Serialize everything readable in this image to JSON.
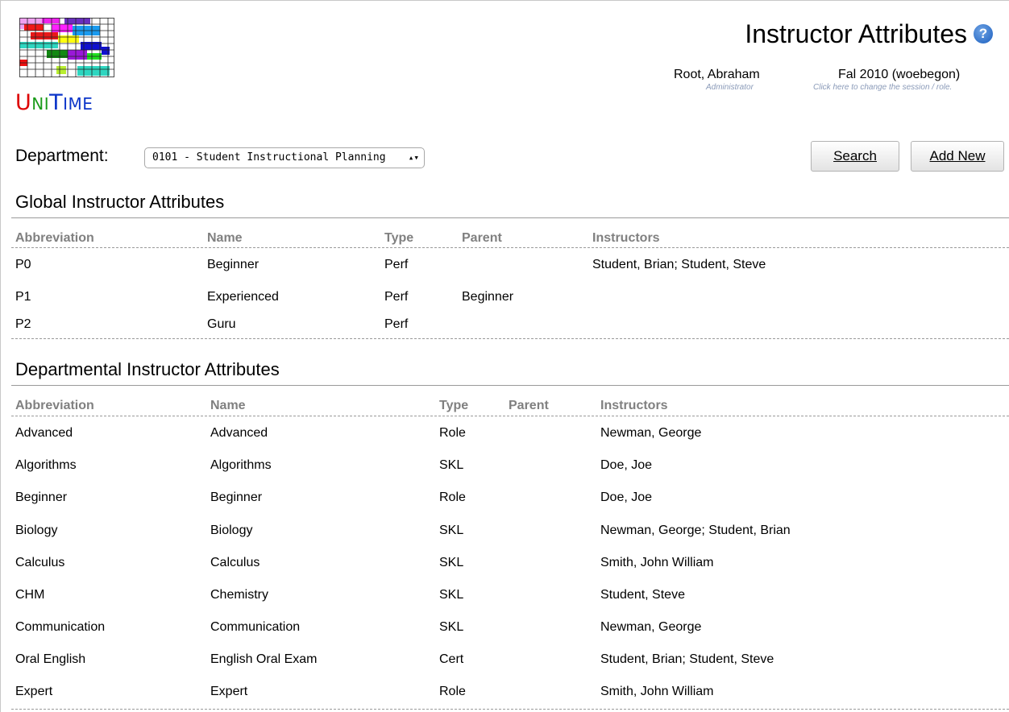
{
  "app": {
    "logo_parts": [
      "U",
      "NI",
      "T",
      "IME"
    ]
  },
  "header": {
    "title": "Instructor Attributes",
    "help_icon": "help-icon",
    "help_glyph": "?",
    "user": {
      "name": "Root, Abraham",
      "role": "Administrator"
    },
    "session": {
      "name": "Fal 2010 (woebegon)",
      "hint": "Click here to change the session / role."
    }
  },
  "filter": {
    "department_label": "Department:",
    "department_value": "0101 - Student Instructional Planning",
    "select_arrows": "▴▾",
    "search_label": "Search",
    "add_label": "Add New"
  },
  "global": {
    "title": "Global Instructor Attributes",
    "columns": [
      "Abbreviation",
      "Name",
      "Type",
      "Parent",
      "Instructors"
    ],
    "rows": [
      {
        "abbreviation": "P0",
        "name": "Beginner",
        "type": "Perf",
        "parent": "",
        "instructors": "Student, Brian; Student, Steve"
      },
      {
        "abbreviation": "P1",
        "name": "Experienced",
        "type": "Perf",
        "parent": "Beginner",
        "instructors": ""
      },
      {
        "abbreviation": "P2",
        "name": "Guru",
        "type": "Perf",
        "parent": "",
        "instructors": ""
      }
    ]
  },
  "departmental": {
    "title": "Departmental Instructor Attributes",
    "columns": [
      "Abbreviation",
      "Name",
      "Type",
      "Parent",
      "Instructors"
    ],
    "rows": [
      {
        "abbreviation": "Advanced",
        "name": "Advanced",
        "type": "Role",
        "parent": "",
        "instructors": "Newman, George"
      },
      {
        "abbreviation": "Algorithms",
        "name": "Algorithms",
        "type": "SKL",
        "parent": "",
        "instructors": "Doe, Joe"
      },
      {
        "abbreviation": "Beginner",
        "name": "Beginner",
        "type": "Role",
        "parent": "",
        "instructors": "Doe, Joe"
      },
      {
        "abbreviation": "Biology",
        "name": "Biology",
        "type": "SKL",
        "parent": "",
        "instructors": "Newman, George; Student, Brian"
      },
      {
        "abbreviation": "Calculus",
        "name": "Calculus",
        "type": "SKL",
        "parent": "",
        "instructors": "Smith, John William"
      },
      {
        "abbreviation": "CHM",
        "name": "Chemistry",
        "type": "SKL",
        "parent": "",
        "instructors": "Student, Steve"
      },
      {
        "abbreviation": "Communication",
        "name": "Communication",
        "type": "SKL",
        "parent": "",
        "instructors": "Newman, George"
      },
      {
        "abbreviation": "Oral English",
        "name": "English Oral Exam",
        "type": "Cert",
        "parent": "",
        "instructors": "Student, Brian; Student, Steve"
      },
      {
        "abbreviation": "Expert",
        "name": "Expert",
        "type": "Role",
        "parent": "",
        "instructors": "Smith, John William"
      }
    ]
  }
}
